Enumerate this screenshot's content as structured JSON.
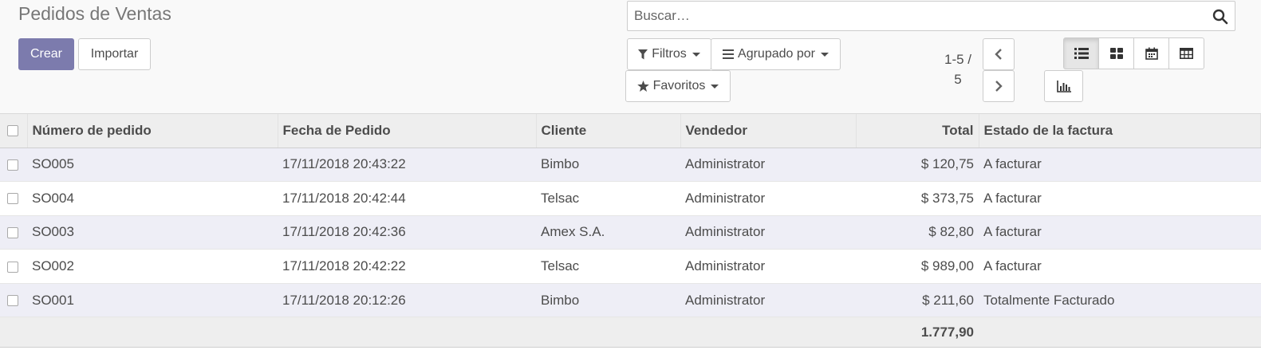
{
  "page": {
    "title": "Pedidos de Ventas"
  },
  "buttons": {
    "create": "Crear",
    "import": "Importar"
  },
  "search": {
    "placeholder": "Buscar…"
  },
  "filters": {
    "filters_label": "Filtros",
    "group_by_label": "Agrupado por",
    "favorites_label": "Favoritos"
  },
  "pager": {
    "value": "1-5 / 5"
  },
  "views": [
    "list-icon",
    "kanban-icon",
    "calendar-icon",
    "pivot-icon",
    "graph-icon"
  ],
  "colors": {
    "primary": "#7c7bad",
    "row_stripe": "#eeeef6",
    "header_bg": "#eeeeee"
  },
  "table": {
    "columns": [
      "Número de pedido",
      "Fecha de Pedido",
      "Cliente",
      "Vendedor",
      "Total",
      "Estado de la factura"
    ],
    "rows": [
      [
        "SO005",
        "17/11/2018 20:43:22",
        "Bimbo",
        "Administrator",
        "$ 120,75",
        "A facturar"
      ],
      [
        "SO004",
        "17/11/2018 20:42:44",
        "Telsac",
        "Administrator",
        "$ 373,75",
        "A facturar"
      ],
      [
        "SO003",
        "17/11/2018 20:42:36",
        "Amex S.A.",
        "Administrator",
        "$ 82,80",
        "A facturar"
      ],
      [
        "SO002",
        "17/11/2018 20:42:22",
        "Telsac",
        "Administrator",
        "$ 989,00",
        "A facturar"
      ],
      [
        "SO001",
        "17/11/2018 20:12:26",
        "Bimbo",
        "Administrator",
        "$ 211,60",
        "Totalmente Facturado"
      ]
    ],
    "footer_total": "1.777,90"
  }
}
